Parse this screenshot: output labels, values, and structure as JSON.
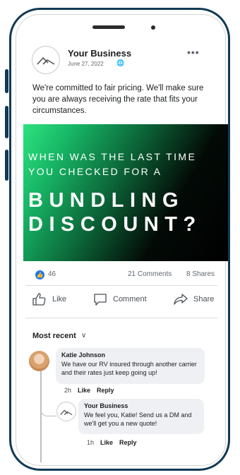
{
  "post": {
    "author": "Your Business",
    "date": "June 27, 2022",
    "privacy_icon": "globe-icon",
    "body": "We're committed to fair pricing. We'll make sure you are always receiving the rate that fits your circumstances.",
    "banner": {
      "line1": "WHEN WAS THE LAST TIME",
      "line2": "YOU CHECKED FOR A",
      "big1": "BUNDLING",
      "big2": "DISCOUNT?",
      "gradient_colors": [
        "#2ee27f",
        "#0c6b3b",
        "#000000"
      ]
    },
    "reactions_count": "46",
    "comments_count": "21 Comments",
    "shares_count": "8 Shares"
  },
  "actions": {
    "like": "Like",
    "comment": "Comment",
    "share": "Share"
  },
  "comments": {
    "sort_label": "Most recent",
    "first": {
      "author": "Katie Johnson",
      "text": "We have our RV insured through another carrier and their rates just keep going up!",
      "time": "2h",
      "like": "Like",
      "reply": "Reply"
    },
    "reply": {
      "author": "Your Business",
      "text": "We feel you, Katie! Send us a DM and we'll get you a new quote!",
      "time": "1h",
      "like": "Like",
      "reply": "Reply"
    }
  },
  "colors": {
    "phone_frame": "#103a55",
    "reaction": "#1877f2",
    "bubble": "#eef0f3"
  }
}
